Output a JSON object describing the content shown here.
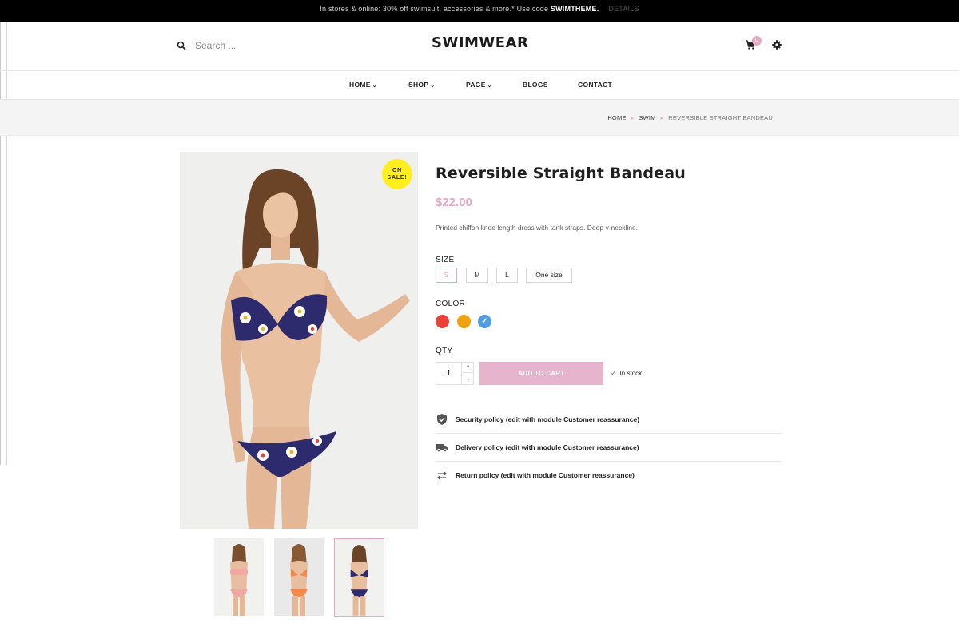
{
  "promo": {
    "text": "In stores & online: 30% off swimsuit, accessories & more.* Use code ",
    "code": "SWIMTHEME",
    "details": "DETAILS"
  },
  "header": {
    "search_placeholder": "Search ...",
    "logo": "SWIMWEAR",
    "cart_count": "0"
  },
  "nav": {
    "items": [
      {
        "label": "HOME",
        "has_dropdown": true
      },
      {
        "label": "SHOP",
        "has_dropdown": true
      },
      {
        "label": "PAGE",
        "has_dropdown": true
      },
      {
        "label": "BLOGS",
        "has_dropdown": false
      },
      {
        "label": "CONTACT",
        "has_dropdown": false
      }
    ]
  },
  "breadcrumb": [
    "HOME",
    "SWIM",
    "REVERSIBLE STRAIGHT BANDEAU"
  ],
  "product": {
    "badge": "ON SALE!",
    "title": "Reversible Straight Bandeau",
    "price": "$22.00",
    "description": "Printed chiffon knee length dress with tank straps. Deep v-neckline.",
    "size_label": "SIZE",
    "sizes": [
      "S",
      "M",
      "L",
      "One size"
    ],
    "selected_size": "S",
    "color_label": "COLOR",
    "colors": [
      "#e8423a",
      "#f0a20f",
      "#4f9de4"
    ],
    "selected_color_index": 2,
    "qty_label": "QTY",
    "qty_value": "1",
    "add_to_cart": "ADD TO CART",
    "stock": "In stock"
  },
  "reassurance": [
    {
      "icon": "shield-icon",
      "text": "Security policy (edit with module Customer reassurance)"
    },
    {
      "icon": "truck-icon",
      "text": "Delivery policy (edit with module Customer reassurance)"
    },
    {
      "icon": "exchange-arrows-icon",
      "text": "Return policy (edit with module Customer reassurance)"
    }
  ],
  "colors": {
    "accent": "#e6a8c4",
    "badge": "#ffef1f",
    "topbar": "#000000"
  }
}
